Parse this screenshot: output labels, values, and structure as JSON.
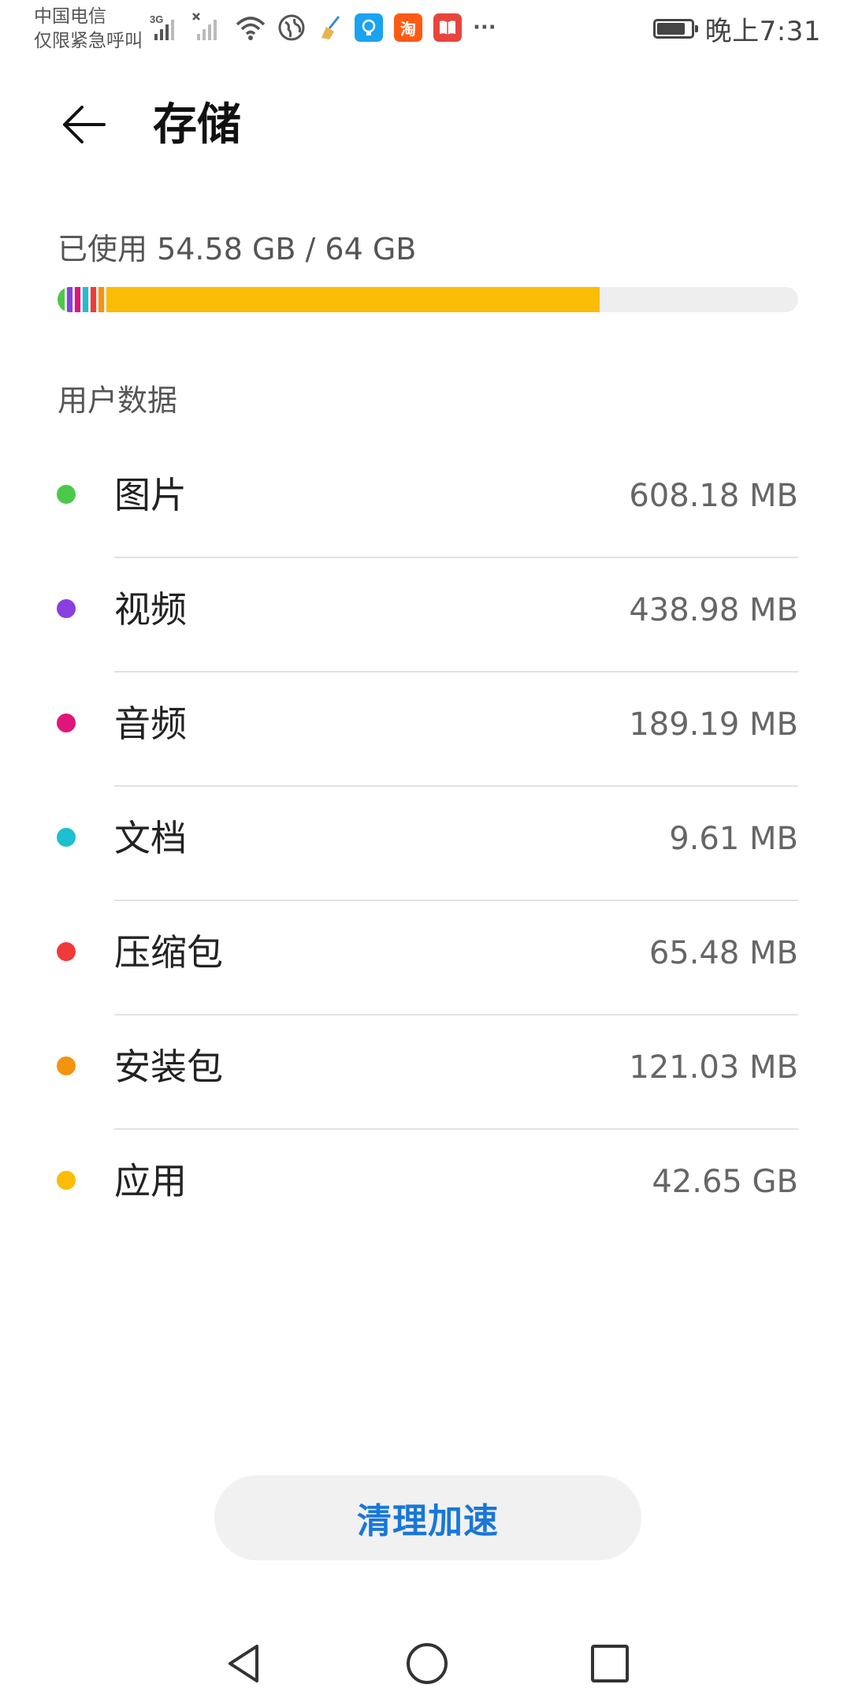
{
  "status_bar": {
    "carrier_line1": "中国电信",
    "carrier_line2": "仅限紧急呼叫",
    "network_type": "3G",
    "taobao_label": "淘",
    "more_label": "···",
    "time": "晚上7:31",
    "battery_level": 0.85,
    "icons": [
      "signal-3g-icon",
      "signal-no-sim-icon",
      "wifi-icon",
      "globe-icon",
      "broom-icon",
      "bulb-app-icon",
      "taobao-app-icon",
      "book-app-icon",
      "more-notifications-icon",
      "battery-icon"
    ]
  },
  "header": {
    "title": "存储",
    "back_icon": "arrow-left-icon"
  },
  "usage": {
    "text": "已使用 54.58 GB / 64 GB",
    "used_gb": 54.58,
    "total_gb": 64,
    "track_color": "#eeeeee"
  },
  "section": {
    "title": "用户数据"
  },
  "items": [
    {
      "label": "图片",
      "size": "608.18 MB",
      "color": "#4cc84a"
    },
    {
      "label": "视频",
      "size": "438.98 MB",
      "color": "#8a3fe0"
    },
    {
      "label": "音频",
      "size": "189.19 MB",
      "color": "#e0157a"
    },
    {
      "label": "文档",
      "size": "9.61 MB",
      "color": "#1ebfd0"
    },
    {
      "label": "压缩包",
      "size": "65.48 MB",
      "color": "#f03a3a"
    },
    {
      "label": "安装包",
      "size": "121.03 MB",
      "color": "#f5930e"
    },
    {
      "label": "应用",
      "size": "42.65 GB",
      "color": "#fbbc05"
    }
  ],
  "clean_button": {
    "label": "清理加速",
    "color": "#1877d8"
  },
  "nav_bar": {
    "icons": [
      "back-triangle-icon",
      "home-circle-icon",
      "recents-square-icon"
    ]
  }
}
